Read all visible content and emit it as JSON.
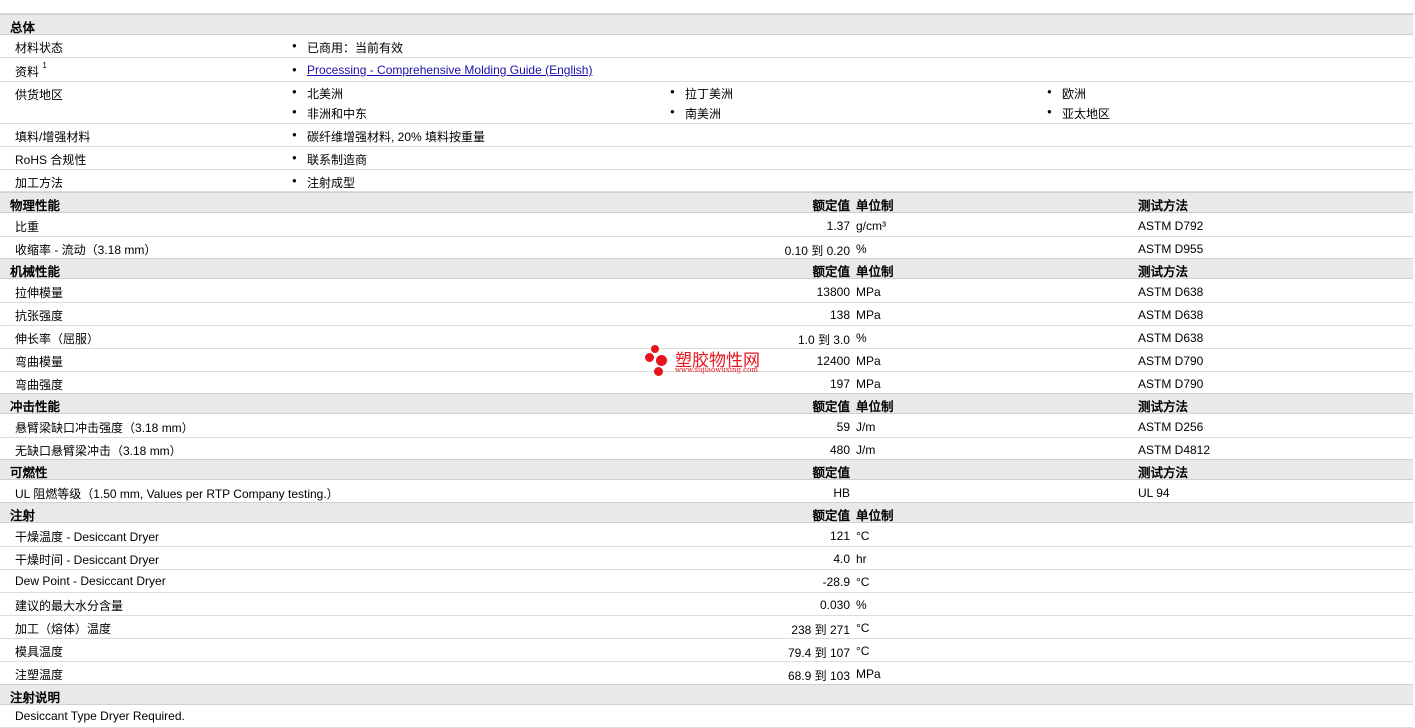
{
  "general": {
    "title": "总体",
    "rows": [
      {
        "label": "材料状态",
        "items": [
          "已商用：当前有效"
        ]
      },
      {
        "label": "资料",
        "sup": "1",
        "link": "Processing - Comprehensive Molding Guide (English)"
      },
      {
        "label": "供货地区",
        "items": [
          "北美洲",
          "拉丁美洲",
          "欧洲",
          "非洲和中东",
          "南美洲",
          "亚太地区"
        ]
      },
      {
        "label": "填料/增强材料",
        "items": [
          "碳纤维增强材料, 20% 填料按重量"
        ]
      },
      {
        "label": "RoHS 合规性",
        "items": [
          "联系制造商"
        ]
      },
      {
        "label": "加工方法",
        "items": [
          "注射成型"
        ]
      }
    ]
  },
  "sections": [
    {
      "title": "物理性能",
      "h_value": "额定值",
      "h_unit": "单位制",
      "h_method": "测试方法",
      "rows": [
        {
          "label": "比重",
          "value": "1.37",
          "unit": "g/cm³",
          "method": "ASTM D792"
        },
        {
          "label": "收缩率 - 流动（3.18 mm）",
          "value": "0.10 到  0.20",
          "unit": "%",
          "method": "ASTM D955"
        }
      ]
    },
    {
      "title": "机械性能",
      "h_value": "额定值",
      "h_unit": "单位制",
      "h_method": "测试方法",
      "rows": [
        {
          "label": "拉伸模量",
          "value": "13800",
          "unit": "MPa",
          "method": "ASTM D638"
        },
        {
          "label": "抗张强度",
          "value": "138",
          "unit": "MPa",
          "method": "ASTM D638"
        },
        {
          "label": "伸长率（屈服）",
          "value": "1.0 到  3.0",
          "unit": "%",
          "method": "ASTM D638"
        },
        {
          "label": "弯曲模量",
          "value": "12400",
          "unit": "MPa",
          "method": "ASTM D790"
        },
        {
          "label": "弯曲强度",
          "value": "197",
          "unit": "MPa",
          "method": "ASTM D790"
        }
      ]
    },
    {
      "title": "冲击性能",
      "h_value": "额定值",
      "h_unit": "单位制",
      "h_method": "测试方法",
      "rows": [
        {
          "label": "悬臂梁缺口冲击强度（3.18 mm）",
          "value": "59",
          "unit": "J/m",
          "method": "ASTM D256"
        },
        {
          "label": "无缺口悬臂梁冲击（3.18 mm）",
          "value": "480",
          "unit": "J/m",
          "method": "ASTM D4812"
        }
      ]
    },
    {
      "title": "可燃性",
      "h_value": "额定值",
      "h_unit": "",
      "h_method": "测试方法",
      "rows": [
        {
          "label": "UL 阻燃等级（1.50 mm, Values per RTP Company testing.）",
          "value": "HB",
          "unit": "",
          "method": "UL 94"
        }
      ]
    },
    {
      "title": "注射",
      "h_value": "额定值",
      "h_unit": "单位制",
      "h_method": "",
      "rows": [
        {
          "label": "干燥温度 - Desiccant Dryer",
          "value": "121",
          "unit": "°C",
          "method": ""
        },
        {
          "label": "干燥时间 - Desiccant Dryer",
          "value": "4.0",
          "unit": "hr",
          "method": ""
        },
        {
          "label": "Dew Point - Desiccant Dryer",
          "value": "-28.9",
          "unit": "°C",
          "method": ""
        },
        {
          "label": "建议的最大水分含量",
          "value": "0.030",
          "unit": "%",
          "method": ""
        },
        {
          "label": "加工（熔体）温度",
          "value": "238 到  271",
          "unit": "°C",
          "method": ""
        },
        {
          "label": "模具温度",
          "value": "79.4 到  107",
          "unit": "°C",
          "method": ""
        },
        {
          "label": "注塑温度",
          "value": "68.9 到  103",
          "unit": "MPa",
          "method": ""
        }
      ]
    },
    {
      "title": "注射说明",
      "h_value": "",
      "h_unit": "",
      "h_method": "",
      "rows": [
        {
          "label": "Desiccant Type Dryer Required.",
          "value": "",
          "unit": "",
          "method": ""
        }
      ]
    }
  ],
  "watermark": {
    "name": "塑胶物性网",
    "url": "www.sujiaowuxing.com",
    "color": "#e8141c"
  }
}
